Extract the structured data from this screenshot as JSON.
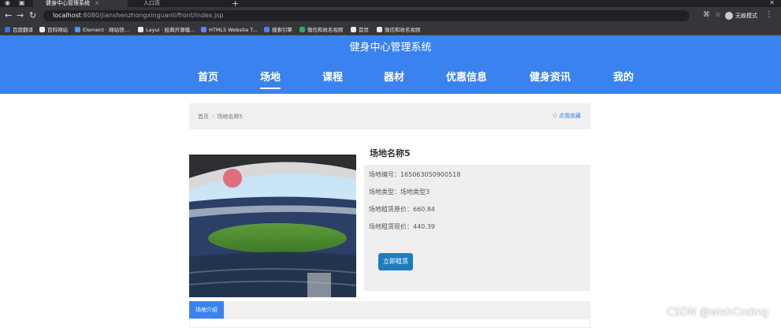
{
  "browser": {
    "tabs": [
      {
        "title": "健身中心管理系统",
        "active": true
      },
      {
        "title": "入口页",
        "active": false
      }
    ],
    "url_host": "localhost",
    "url_path": ":8080/jianshenzhongxinguanli/front/index.jsp",
    "incognito_label": "无痕模式",
    "bookmarks": [
      {
        "label": "百度翻译",
        "color": "#3b6fe0"
      },
      {
        "label": "百科网站",
        "color": "#e8eaed"
      },
      {
        "label": "Element · 网站快...",
        "color": "#409eff"
      },
      {
        "label": "Layui · 经典开源模...",
        "color": "#e8eaed"
      },
      {
        "label": "HTML5 Website T...",
        "color": "#6b7cff"
      },
      {
        "label": "搜索引擎",
        "color": "#4285f4"
      },
      {
        "label": "微信和收名视频",
        "color": "#2aae67"
      },
      {
        "label": "首页",
        "color": "#e8eaed"
      },
      {
        "label": "微信和收名视频",
        "color": "#e8eaed"
      }
    ]
  },
  "site": {
    "title": "健身中心管理系统",
    "accent": "#3a82f0",
    "nav": [
      {
        "label": "首页",
        "active": false
      },
      {
        "label": "场地",
        "active": true
      },
      {
        "label": "课程",
        "active": false
      },
      {
        "label": "器材",
        "active": false
      },
      {
        "label": "优惠信息",
        "active": false
      },
      {
        "label": "健身资讯",
        "active": false
      },
      {
        "label": "我的",
        "active": false
      }
    ]
  },
  "breadcrumb": {
    "home": "首页",
    "separator": "/",
    "current": "场地名称5",
    "favorite_label": "点我收藏"
  },
  "venue": {
    "name": "场地名称5",
    "code_label": "场地编号：",
    "code": "165063050900518",
    "type_label": "场地类型：",
    "type": "场地类型3",
    "original_price_label": "场地租赁原价：",
    "original_price": "660.84",
    "current_price_label": "场地租赁现价：",
    "current_price": "440.39",
    "rent_button": "立即租赁"
  },
  "tabs": {
    "intro": "场地介绍"
  },
  "watermark": "CSDN @wishCoding"
}
